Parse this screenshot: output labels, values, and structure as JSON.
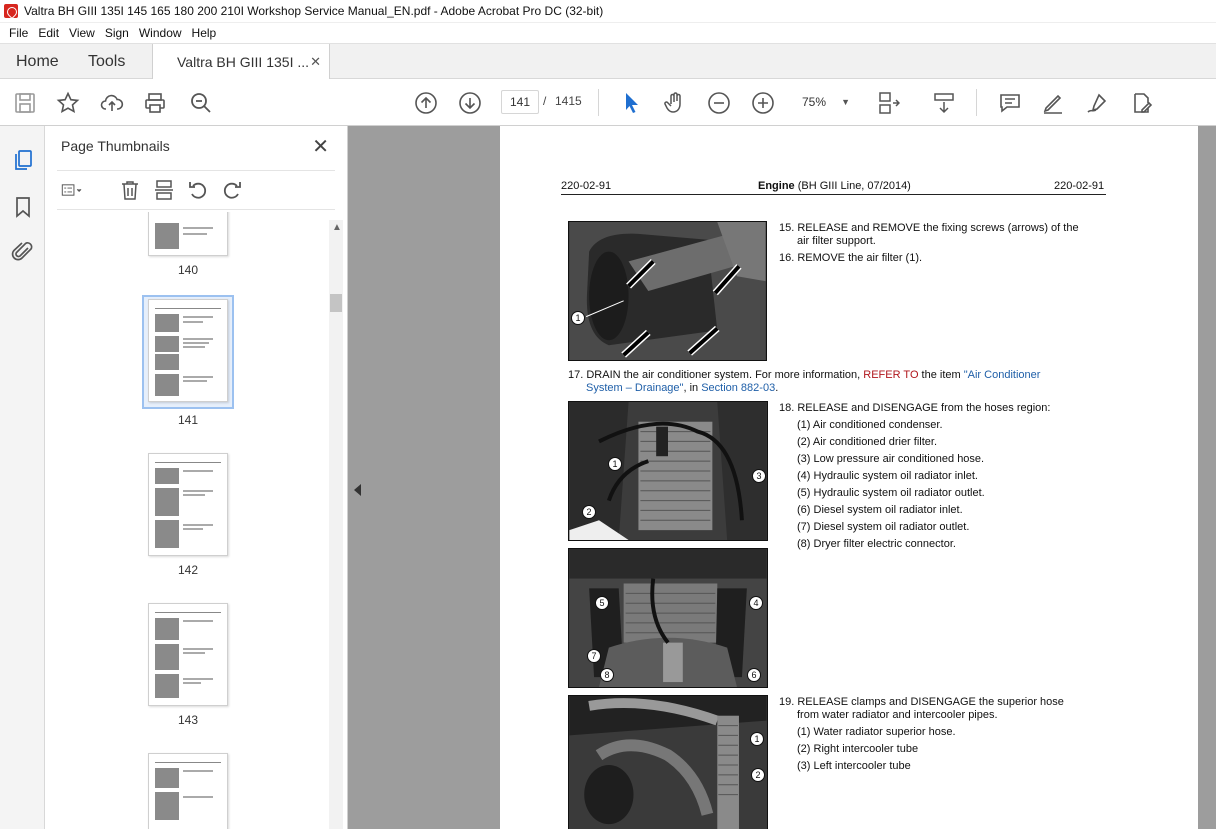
{
  "window": {
    "title": "Valtra BH GIII 135I 145 165 180 200 210I Workshop Service Manual_EN.pdf - Adobe Acrobat Pro DC (32-bit)"
  },
  "menu": [
    "File",
    "Edit",
    "View",
    "Sign",
    "Window",
    "Help"
  ],
  "tabs": {
    "home": "Home",
    "tools": "Tools",
    "document": "Valtra BH GIII 135I ..."
  },
  "toolbar": {
    "current_page": "141",
    "separator": "/",
    "total_pages": "1415",
    "zoom": "75%"
  },
  "thumbnails": {
    "title": "Page Thumbnails",
    "pages": [
      {
        "label": "140"
      },
      {
        "label": "141"
      },
      {
        "label": "142"
      },
      {
        "label": "143"
      }
    ]
  },
  "page": {
    "header_left": "220-02-91",
    "header_center_bold": "Engine",
    "header_center_rest": " (BH GIII Line, 07/2014)",
    "header_right": "220-02-91",
    "step15_line1": "15. RELEASE and REMOVE the fixing screws (arrows) of the",
    "step15_line2": "air filter support.",
    "step16": "16. REMOVE the air filter (1).",
    "step17_a": "17. DRAIN the air conditioner system. For more information, ",
    "step17_refer": "REFER TO",
    "step17_b": " the item ",
    "step17_link1": "\"Air Conditioner",
    "step17_link2": "System – Drainage\"",
    "step17_c": ", in ",
    "step17_link3": "Section 882-03",
    "step17_d": ".",
    "step18": "18. RELEASE and DISENGAGE from the hoses region:",
    "step18_items": [
      "(1)  Air conditioned condenser.",
      "(2)  Air conditioned drier filter.",
      "(3)  Low pressure air conditioned hose.",
      "(4)  Hydraulic system oil radiator inlet.",
      "(5)  Hydraulic system oil radiator outlet.",
      "(6)  Diesel system oil radiator inlet.",
      "(7)  Diesel system oil radiator outlet.",
      "(8)  Dryer filter electric connector."
    ],
    "step19_line1": "19. RELEASE clamps and DISENGAGE the superior hose",
    "step19_line2": "from water radiator and intercooler pipes.",
    "step19_items": [
      "(1)  Water radiator superior hose.",
      "(2)  Right intercooler tube",
      "(3)  Left intercooler tube"
    ],
    "callouts": {
      "p1": [
        "1"
      ],
      "p2": [
        "1",
        "2",
        "3"
      ],
      "p3": [
        "5",
        "4",
        "7",
        "8",
        "6"
      ],
      "p4": [
        "1",
        "2"
      ]
    }
  }
}
